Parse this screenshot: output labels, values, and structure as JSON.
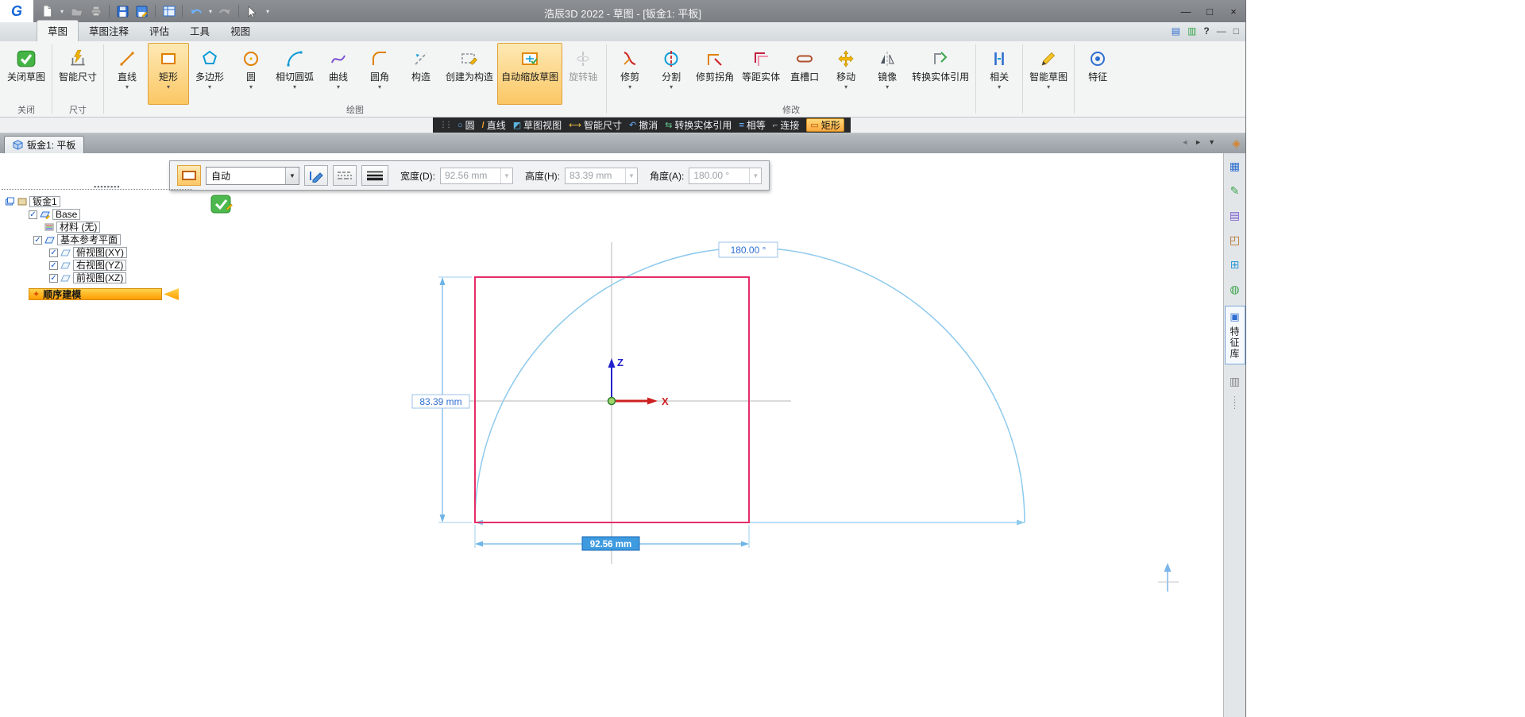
{
  "titlebar": {
    "logo": "G",
    "title": "浩辰3D 2022 - 草图 - [钣金1: 平板]",
    "minimize": "—",
    "maximize": "□",
    "close": "×"
  },
  "tabs": {
    "sketch": "草图",
    "annotation": "草图注释",
    "evaluate": "评估",
    "tools": "工具",
    "view": "视图",
    "help": "?",
    "min_doc": "—",
    "restore_doc": "□"
  },
  "ribbon": {
    "close_sketch": "关闭草图",
    "group_close": "关闭",
    "smart_dimension": "智能尺寸",
    "group_dimension": "尺寸",
    "line": "直线",
    "rectangle": "矩形",
    "polygon": "多边形",
    "circle": "圆",
    "tangent_arc": "相切圆弧",
    "curve": "曲线",
    "fillet": "圆角",
    "construction": "构造",
    "make_construction": "创建为构造",
    "auto_scale": "自动缩放草图",
    "rotation_axis": "旋转轴",
    "group_draw": "绘图",
    "trim": "修剪",
    "split": "分割",
    "trim_corner": "修剪拐角",
    "offset": "等距实体",
    "slot": "直槽口",
    "move": "移动",
    "mirror": "镜像",
    "include": "转换实体引用",
    "group_modify": "修改",
    "relate": "相关",
    "smart_sketch": "智能草图",
    "feature": "特征"
  },
  "prompt": {
    "circle": "圆",
    "line": "直线",
    "sketch_view": "草图视图",
    "smart_dimension": "智能尺寸",
    "undo": "撤消",
    "include": "转换实体引用",
    "equal": "相等",
    "connect": "连接",
    "rectangle": "矩形"
  },
  "doctab": {
    "label": "钣金1: 平板"
  },
  "optbar": {
    "mode": "自动",
    "width_label": "宽度(D):",
    "width_value": "92.56 mm",
    "height_label": "高度(H):",
    "height_value": "83.39 mm",
    "angle_label": "角度(A):",
    "angle_value": "180.00 °"
  },
  "tree": {
    "root": "钣金1",
    "base": "Base",
    "material": "材料 (无)",
    "ref_planes": "基本参考平面",
    "top_view": "俯视图(XY)",
    "right_view": "右视图(YZ)",
    "front_view": "前视图(XZ)",
    "mode_bar": "顺序建模"
  },
  "canvas": {
    "height_dim": "83.39 mm",
    "width_dim": "92.56 mm",
    "angle_dim": "180.00 °",
    "axis_z": "Z",
    "axis_x": "X"
  },
  "rightbar": {
    "feature_library": "特征库"
  }
}
